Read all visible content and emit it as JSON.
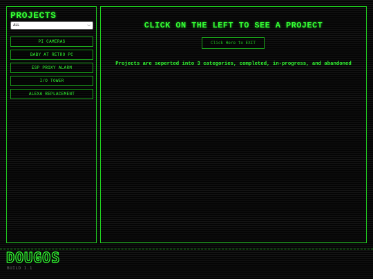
{
  "sidebar": {
    "title": "PROJECTS",
    "filter": {
      "selected": "ALL"
    },
    "items": [
      {
        "label": "PI CAMERAS"
      },
      {
        "label": "BABY AT RETRO PC"
      },
      {
        "label": "ESP PROXY ALARM"
      },
      {
        "label": "I/O TOWER"
      },
      {
        "label": "ALEXA REPLACEMENT"
      }
    ]
  },
  "main": {
    "heading": "CLICK ON THE LEFT TO SEE A PROJECT",
    "exit_label": "Click Here to EXIT",
    "description": "Projects are seperted into 3 categories, completed, in-progress, and abandoned"
  },
  "footer": {
    "brand": "DOUGOS",
    "build": "BUILD 1.1"
  },
  "colors": {
    "accent": "#33ff33",
    "border": "#1fd11f",
    "background": "#0a0a0a"
  },
  "icons": {
    "filter_chevron": "chevron-down-icon"
  }
}
